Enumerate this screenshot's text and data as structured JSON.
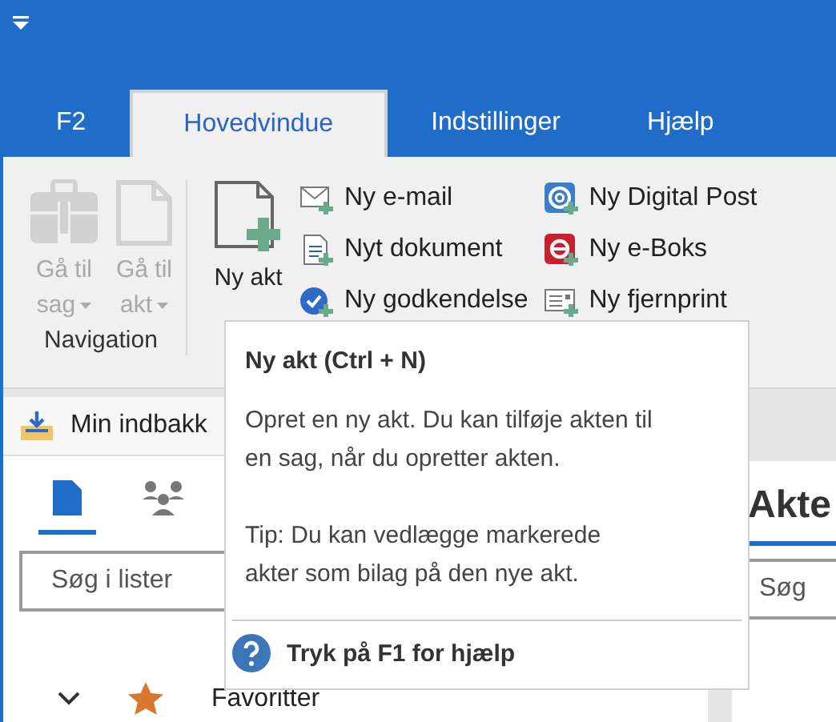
{
  "tabs": [
    {
      "label": "F2",
      "selected": false
    },
    {
      "label": "Hovedvindue",
      "selected": true
    },
    {
      "label": "Indstillinger",
      "selected": false
    },
    {
      "label": "Hjælp",
      "selected": false
    }
  ],
  "navigation": {
    "label": "Navigation",
    "buttons": [
      {
        "kind": "case",
        "line1": "Gå til",
        "line2": "sag",
        "disabled": true
      },
      {
        "kind": "document",
        "line1": "Gå til",
        "line2": "akt",
        "disabled": true
      }
    ]
  },
  "new_group": {
    "big_button": {
      "label": "Ny akt"
    },
    "items": [
      {
        "kind": "email",
        "label": "Ny e-mail"
      },
      {
        "kind": "document",
        "label": "Nyt dokument"
      },
      {
        "kind": "approval",
        "label": "Ny godkendelse"
      },
      {
        "kind": "digital-post",
        "label": "Ny Digital Post"
      },
      {
        "kind": "eboks",
        "label": "Ny e-Boks"
      },
      {
        "kind": "remote-print",
        "label": "Ny fjernprint"
      }
    ]
  },
  "left_pane": {
    "tab": "Min indbakk",
    "view_icons": [
      {
        "kind": "document",
        "selected": true
      },
      {
        "kind": "people",
        "selected": false
      }
    ],
    "search": {
      "placeholder": "Søg i lister"
    },
    "tree": [
      {
        "label": "Favoritter",
        "expanded": true
      }
    ]
  },
  "right_pane": {
    "heading": "Akte",
    "search": {
      "placeholder": "Søg"
    }
  },
  "tooltip": {
    "title": "Ny akt (Ctrl + N)",
    "paragraphs": [
      "Opret en ny akt. Du kan tilføje akten til en sag, når du opretter akten.",
      "Tip: Du kan vedlægge markerede akter som bilag på den nye akt."
    ],
    "help": "Tryk på F1 for hjælp"
  }
}
